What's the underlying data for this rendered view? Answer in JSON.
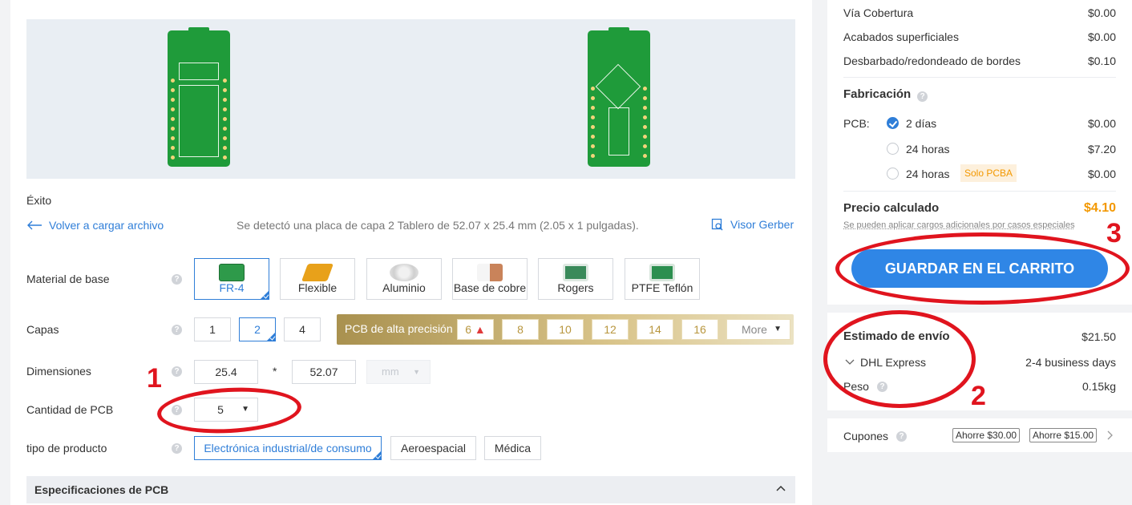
{
  "preview": {},
  "status": {
    "success": "Éxito"
  },
  "upload": {
    "back_label": "Volver a cargar archivo",
    "detected_text": "Se detectó una placa de capa 2 Tablero de 52.07 x 25.4 mm (2.05 x 1 pulgadas).",
    "gerber_label": "Visor Gerber"
  },
  "form": {
    "material_label": "Material de base",
    "materials": [
      {
        "label": "FR-4",
        "selected": true
      },
      {
        "label": "Flexible"
      },
      {
        "label": "Aluminio"
      },
      {
        "label": "Base de cobre"
      },
      {
        "label": "Rogers"
      },
      {
        "label": "PTFE Teflón"
      }
    ],
    "layers_label": "Capas",
    "layers": [
      {
        "label": "1"
      },
      {
        "label": "2",
        "selected": true
      },
      {
        "label": "4"
      }
    ],
    "high_precision_label": "PCB de alta precisión",
    "hp_layers": [
      {
        "label": "6"
      },
      {
        "label": "8"
      },
      {
        "label": "10"
      },
      {
        "label": "12"
      },
      {
        "label": "14"
      },
      {
        "label": "16"
      }
    ],
    "more_label": "More",
    "dimensions_label": "Dimensiones",
    "dim_width": "25.4",
    "dim_sep": "*",
    "dim_height": "52.07",
    "dim_unit": "mm",
    "quantity_label": "Cantidad de PCB",
    "quantity_value": "5",
    "product_type_label": "tipo de producto",
    "product_types": [
      {
        "label": "Electrónica industrial/de consumo",
        "selected": true
      },
      {
        "label": "Aeroespacial"
      },
      {
        "label": "Médica"
      }
    ],
    "specs_label": "Especificaciones de PCB"
  },
  "pricing": {
    "lines": [
      {
        "label": "Vía Cobertura",
        "value": "$0.00"
      },
      {
        "label": "Acabados superficiales",
        "value": "$0.00"
      },
      {
        "label": "Desbarbado/redondeado de bordes",
        "value": "$0.10"
      }
    ],
    "fabrication_label": "Fabricación",
    "pcb_label": "PCB:",
    "fab_options": [
      {
        "label": "2 días",
        "value": "$0.00",
        "selected": true
      },
      {
        "label": "24 horas",
        "value": "$7.20"
      },
      {
        "label": "24 horas",
        "value": "$0.00",
        "tag": "Solo PCBA"
      }
    ],
    "calc_label": "Precio calculado",
    "calc_value": "$4.10",
    "note": "Se pueden aplicar cargos adicionales por casos especiales",
    "cart_button": "GUARDAR EN EL CARRITO"
  },
  "shipping": {
    "title": "Estimado de envío",
    "value": "$21.50",
    "carrier": "DHL Express",
    "carrier_time": "2-4 business days",
    "weight_label": "Peso",
    "weight_value": "0.15kg"
  },
  "coupons": {
    "label": "Cupones",
    "tags": [
      "Ahorre $30.00",
      "Ahorre $15.00"
    ]
  },
  "annotations": {
    "n1": "1",
    "n2": "2",
    "n3": "3"
  },
  "colors": {
    "accent": "#2f7ed8",
    "price": "#f39800",
    "annotation": "#e0141e",
    "precision_gold": "#c3a862"
  }
}
